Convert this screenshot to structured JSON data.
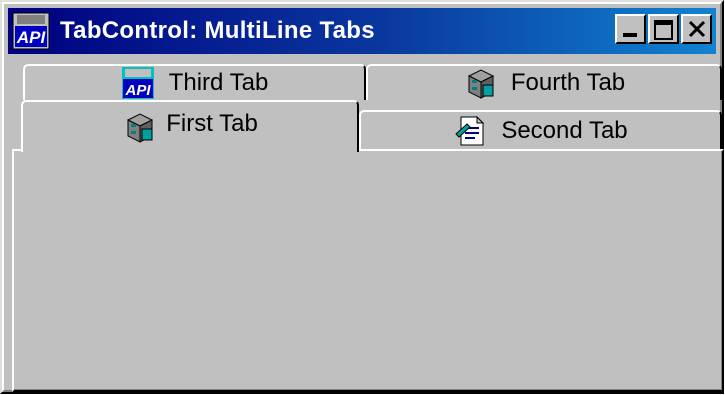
{
  "window": {
    "title": "TabControl: MultiLine Tabs",
    "app_icon": "api-icon",
    "app_icon_text": "API"
  },
  "caption_buttons": {
    "minimize": "minimize-icon",
    "maximize": "maximize-icon",
    "close": "close-icon"
  },
  "tabs": {
    "row_back": [
      {
        "label": "Third Tab",
        "icon": "api-icon"
      },
      {
        "label": "Fourth Tab",
        "icon": "file-cabinet-icon"
      }
    ],
    "row_front": [
      {
        "label": "First Tab",
        "icon": "file-cabinet-icon",
        "selected": true
      },
      {
        "label": "Second Tab",
        "icon": "document-icon",
        "selected": false
      }
    ]
  },
  "colors": {
    "face": "#c0c0c0",
    "title_start": "#000080",
    "title_end": "#1084d0"
  }
}
